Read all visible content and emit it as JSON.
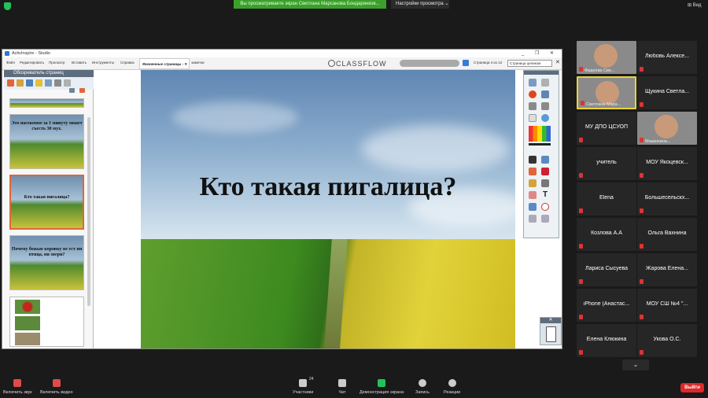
{
  "top": {
    "share_banner": "Вы просматриваете экран Светлана Марсанова Бондаренков...",
    "view_settings": "Настройки просмотра ⌄",
    "view_button": "⊞ Вид"
  },
  "app": {
    "title": "ActivInspire - Studio",
    "window_controls": "_ ❐ ✕",
    "menu": [
      "Файл",
      "Редактировать",
      "Просмотр",
      "Вставить",
      "Инструменты",
      "Справка"
    ],
    "tab_active": "Жизненные страницы - ✕",
    "tab_other": "заметки",
    "classflow": "CLASSFLOW",
    "page_info": "Страница 4 из 12",
    "page_view": "Страница целиком"
  },
  "browser": {
    "header": "Обозреватель страниц",
    "thumbs": [
      {
        "text": ""
      },
      {
        "text": "Это насекомое за 1 минуту может съесть 30 мух."
      },
      {
        "text": "Кто такая пигалица?"
      },
      {
        "text": "Почему божью коровку не ест ни птица, ни звери?"
      },
      {
        "text": ""
      }
    ]
  },
  "slide": {
    "title": "Кто такая пигалица?"
  },
  "participants": [
    {
      "name": "",
      "caption": "Фадеева Све...",
      "video": true
    },
    {
      "name": "Любовь Алексе...",
      "caption": "",
      "video": false
    },
    {
      "name": "",
      "caption": "Светлана Мара...",
      "video": true
    },
    {
      "name": "Щукина Светла...",
      "caption": "",
      "video": false
    },
    {
      "name": "МУ ДПО ЦСУОП",
      "caption": "",
      "video": false
    },
    {
      "name": "",
      "caption": "Мазанкина...",
      "video": true
    },
    {
      "name": "учитель",
      "caption": "",
      "video": false
    },
    {
      "name": "МОУ Якоцевск...",
      "caption": "",
      "video": false
    },
    {
      "name": "Elena",
      "caption": "",
      "video": false
    },
    {
      "name": "Большесельскх...",
      "caption": "",
      "video": false
    },
    {
      "name": "Козлова А.А",
      "caption": "",
      "video": false
    },
    {
      "name": "Ольга Вахнина",
      "caption": "",
      "video": false
    },
    {
      "name": "Лариса Сысуева",
      "caption": "",
      "video": false
    },
    {
      "name": "Жарова Елена...",
      "caption": "",
      "video": false
    },
    {
      "name": "iPhone (Анастас...",
      "caption": "",
      "video": false
    },
    {
      "name": "МОУ СШ №4 \"...",
      "caption": "",
      "video": false
    },
    {
      "name": "Елена Клюкина",
      "caption": "",
      "video": false
    },
    {
      "name": "Укова О.С.",
      "caption": "",
      "video": false
    }
  ],
  "bottom": {
    "mute": "Включить звук",
    "video": "Включить видео",
    "participants": "Участники",
    "participants_count": "24",
    "chat": "Чат",
    "share": "Демонстрация экрана",
    "record": "Запись",
    "reactions": "Реакции",
    "leave": "Выйти"
  }
}
